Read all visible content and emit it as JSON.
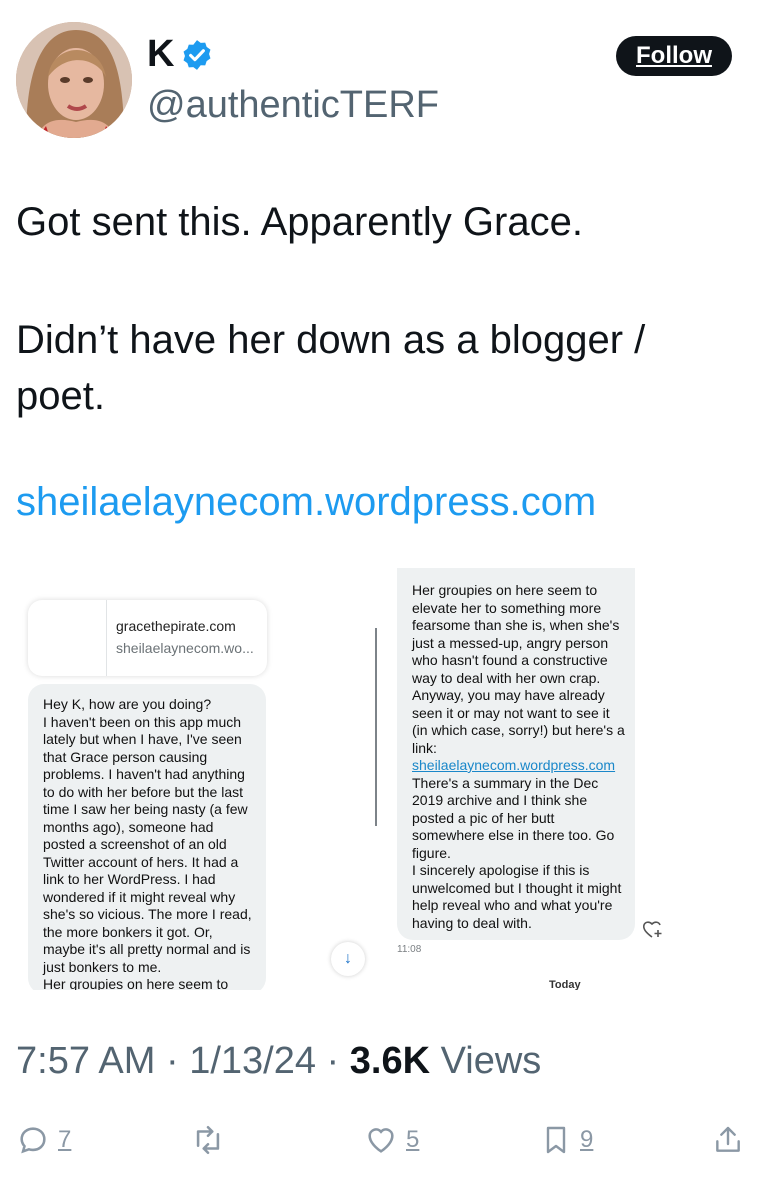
{
  "author": {
    "name": "K",
    "handle": "@authenticTERF",
    "verified": true,
    "follow_label": "Follow"
  },
  "tweet": {
    "line1": "Got sent this. Apparently Grace.",
    "line2": "Didn’t have her down as a blogger / poet.",
    "link": "sheilaelaynecom.wordpress.com"
  },
  "screenshot": {
    "card_title": "gracethepirate.com",
    "card_subtitle": "sheilaelaynecom.wo...",
    "left_message": "Hey K, how are you doing?\nI haven't been on this app much lately but when I have, I've seen that Grace person causing problems. I haven't had anything to do with her before but the last time I saw her being nasty (a few months ago), someone had posted a screenshot of an old Twitter account of hers. It had a link to her WordPress. I had wondered if it might reveal why she's so vicious. The more I read, the more bonkers it got. Or, maybe it's all pretty normal and is just bonkers to me.\nHer groupies on here seem to",
    "right_message_1": "Her groupies on here seem to elevate her to something more fearsome than she is, when she's just a messed-up, angry person who hasn't found a constructive way to deal with her own crap.\nAnyway, you may have already seen it or may not want to see it (in which case, sorry!) but here's a link:",
    "right_link": "sheilaelaynecom.wordpress.com",
    "right_message_2": "There's a summary in the Dec 2019 archive and I think she posted a pic of her butt somewhere else in there too. Go figure.\nI sincerely apologise if this is unwelcomed but I thought it might help reveal who and what you're having to deal with.",
    "time": "11:08",
    "today_label": "Today",
    "scroll_down_icon": "arrow-down-icon"
  },
  "meta": {
    "time": "7:57 AM",
    "date": "1/13/24",
    "views_count": "3.6K",
    "views_label": "Views"
  },
  "actions": {
    "replies": "7",
    "retweets": "",
    "likes": "5",
    "bookmarks": "9"
  },
  "colors": {
    "accent": "#1d9bf0",
    "muted": "#536471",
    "text": "#0f1419"
  }
}
